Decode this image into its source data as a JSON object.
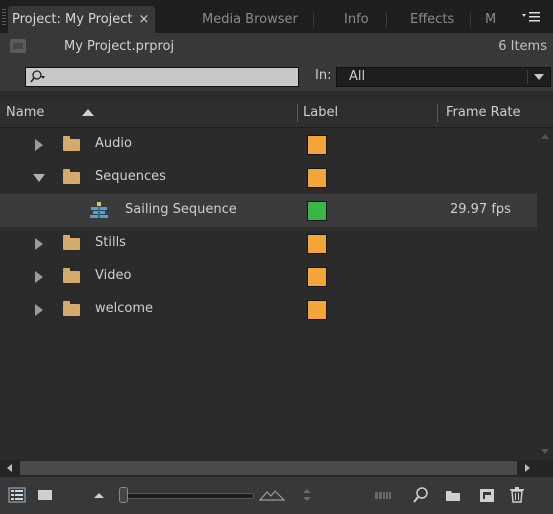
{
  "tabs": [
    {
      "label": "Project: My Project",
      "close": "×",
      "active": true
    },
    {
      "label": "Media Browser"
    },
    {
      "label": "Info"
    },
    {
      "label": "Effects"
    },
    {
      "label": "M"
    }
  ],
  "panel_menu_icon": "panel-menu-icon",
  "project": {
    "name": "My Project.prproj",
    "item_count": "6 Items"
  },
  "search": {
    "value": "",
    "in_label": "In:",
    "in_value": "All"
  },
  "columns": {
    "name": "Name",
    "label": "Label",
    "frame_rate": "Frame Rate"
  },
  "items": [
    {
      "name": "Audio",
      "type": "folder",
      "expanded": false,
      "label_color": "#f4a53a"
    },
    {
      "name": "Sequences",
      "type": "folder",
      "expanded": true,
      "label_color": "#f4a53a"
    },
    {
      "name": "Sailing Sequence",
      "type": "sequence",
      "label_color": "#3ab54a",
      "frame_rate": "29.97 fps"
    },
    {
      "name": "Stills",
      "type": "folder",
      "expanded": false,
      "label_color": "#f4a53a"
    },
    {
      "name": "Video",
      "type": "folder",
      "expanded": false,
      "label_color": "#f4a53a"
    },
    {
      "name": "welcome",
      "type": "folder",
      "expanded": false,
      "label_color": "#f4a53a"
    }
  ],
  "toolbar_icons": [
    "list-view-icon",
    "icon-view-icon",
    "zoom-out-icon",
    "zoom-slider",
    "zoom-in-icon",
    "sort-icons-icon",
    "automate-to-sequence-icon",
    "find-icon",
    "new-bin-icon",
    "new-item-icon",
    "trash-icon"
  ]
}
